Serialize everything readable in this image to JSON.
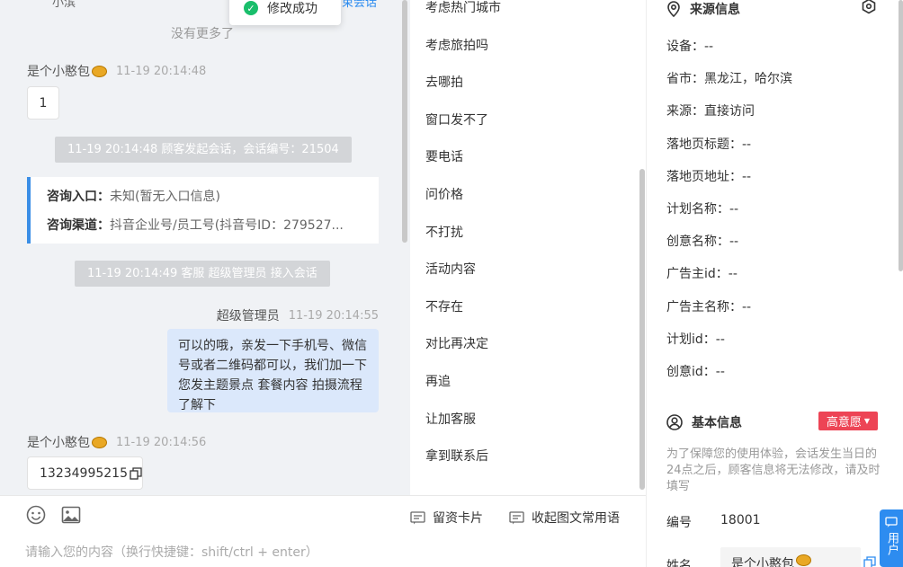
{
  "toast": {
    "text": "修改成功"
  },
  "chat": {
    "peek_name": "小滨",
    "peek_action": "束会话",
    "no_more": "没有更多了",
    "msg1": {
      "sender": "是个小憨包",
      "time": "11-19 20:14:48",
      "text": "1"
    },
    "sys1": "11-19 20:14:48 顾客发起会话，会话编号：21504",
    "info": {
      "entry_label": "咨询入口：",
      "entry_value": "未知(暂无入口信息)",
      "channel_label": "咨询渠道：",
      "channel_value": "抖音企业号/员工号(抖音号ID：279527..."
    },
    "sys2": "11-19 20:14:49 客服 超级管理员 接入会话",
    "msg2": {
      "sender": "超级管理员",
      "time": "11-19 20:14:55",
      "text": "可以的哦，亲发一下手机号、微信号或者二维码都可以，我们加一下您发主题景点 套餐内容 拍摄流程了解下"
    },
    "msg3": {
      "sender": "是个小憨包",
      "time": "11-19 20:14:56",
      "text": "13234995215"
    }
  },
  "composer": {
    "card_label": "留资卡片",
    "collapse_label": "收起图文常用语",
    "placeholder": "请输入您的内容（换行快捷键：shift/ctrl + enter）"
  },
  "quick_replies": [
    "考虑热门城市",
    "考虑旅拍吗",
    "去哪拍",
    "窗口发不了",
    "要电话",
    "问价格",
    "不打扰",
    "活动内容",
    "不存在",
    "对比再决定",
    "再追",
    "让加客服",
    "拿到联系后"
  ],
  "source": {
    "title": "来源信息",
    "fields": [
      {
        "label": "设备：",
        "value": "--"
      },
      {
        "label": "省市：",
        "value": "黑龙江，哈尔滨"
      },
      {
        "label": "来源：",
        "value": "直接访问"
      },
      {
        "label": "落地页标题：",
        "value": "--"
      },
      {
        "label": "落地页地址：",
        "value": "--"
      },
      {
        "label": "计划名称：",
        "value": "--"
      },
      {
        "label": "创意名称：",
        "value": "--"
      },
      {
        "label": "广告主id：",
        "value": "--"
      },
      {
        "label": "广告主名称：",
        "value": "--"
      },
      {
        "label": "计划id：",
        "value": "--"
      },
      {
        "label": "创意id：",
        "value": "--"
      }
    ]
  },
  "basic": {
    "title": "基本信息",
    "badge": "高意愿",
    "hint": "为了保障您的使用体验，会话发生当日的24点之后，顾客信息将无法修改，请及时填写",
    "id_label": "编号",
    "id_value": "18001",
    "name_label": "姓名",
    "name_value": "是个小憨包"
  },
  "float_button": {
    "label": "用户"
  },
  "colors": {
    "accent": "#2d8cf0",
    "badge": "#ed4455",
    "agent_bubble": "#dbe8fb",
    "system": "#d3d5d8"
  }
}
